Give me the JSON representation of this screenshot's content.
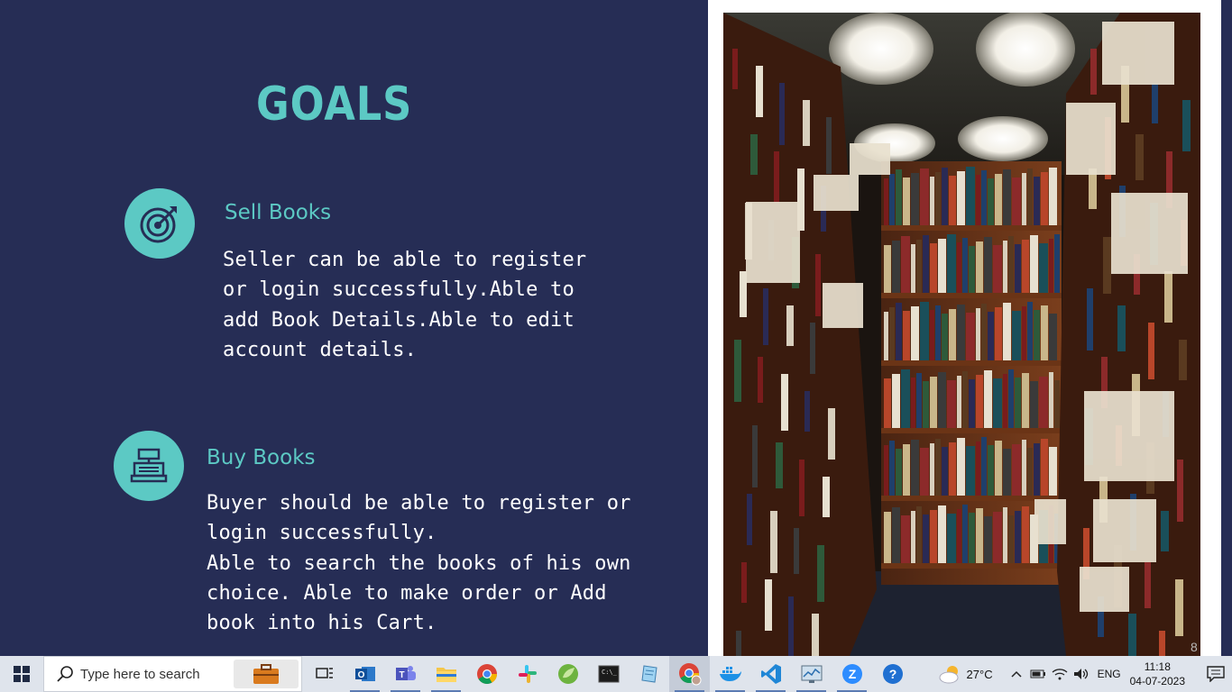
{
  "slide": {
    "title": "GOALS",
    "goals": [
      {
        "heading": "Sell Books",
        "icon": "target-icon",
        "body": "Seller can be able to register\nor login successfully.Able to\nadd Book Details.Able to edit\naccount details."
      },
      {
        "heading": "Buy Books",
        "icon": "cash-register-icon",
        "body": "Buyer should be able to register or\nlogin successfully.\nAble to search the books of his own\nchoice. Able to make order or Add\nbook into his Cart."
      }
    ],
    "photo_icon": "library-bookshelves-photo",
    "slide_number": "8",
    "colors": {
      "background": "#262d55",
      "accent": "#5cc9c4",
      "text": "#ffffff"
    }
  },
  "taskbar": {
    "search_placeholder": "Type here to search",
    "apps": [
      {
        "name": "task-view-icon"
      },
      {
        "name": "outlook-icon"
      },
      {
        "name": "teams-icon"
      },
      {
        "name": "file-explorer-icon"
      },
      {
        "name": "chrome-icon"
      },
      {
        "name": "slack-icon"
      },
      {
        "name": "spring-tool-icon"
      },
      {
        "name": "terminal-icon"
      },
      {
        "name": "notepad-icon"
      },
      {
        "name": "chrome-profile-icon"
      },
      {
        "name": "docker-icon"
      },
      {
        "name": "vscode-icon"
      },
      {
        "name": "resource-monitor-icon"
      },
      {
        "name": "zoom-icon"
      },
      {
        "name": "help-icon"
      }
    ],
    "weather_temp": "27°C",
    "language": "ENG",
    "time": "11:18",
    "date": "04-07-2023"
  }
}
